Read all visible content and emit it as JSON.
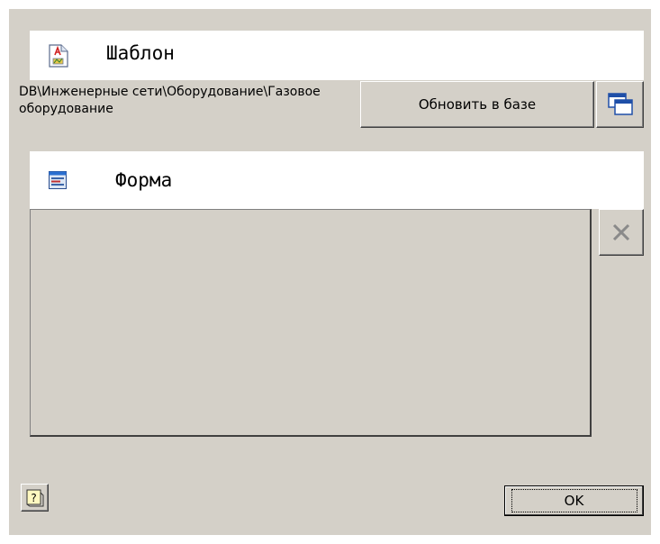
{
  "template": {
    "title": "Шаблон",
    "path": "DB\\Инженерные сети\\Оборудование\\Газовое оборудование",
    "update_button": "Обновить в базе"
  },
  "form": {
    "title": "Форма"
  },
  "icons": {
    "template": "document-template-icon",
    "form": "form-icon",
    "copy": "copy-windows-icon",
    "delete": "close-x-icon",
    "help": "help-question-icon"
  },
  "footer": {
    "ok_label": "OK"
  }
}
